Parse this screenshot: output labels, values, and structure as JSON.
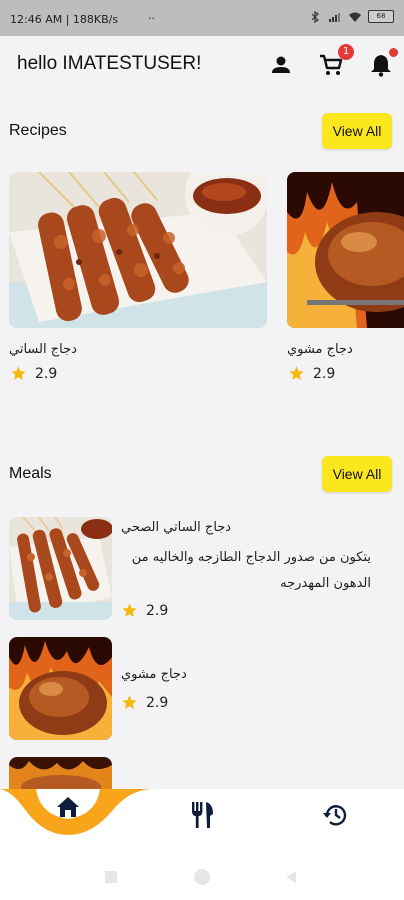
{
  "status_bar": {
    "time_info": "12:46 AM | 188KB/s",
    "dots": "··",
    "battery": "68"
  },
  "header": {
    "greeting": "hello IMATESTUSER!",
    "cart_count": "1"
  },
  "recipes": {
    "title": "Recipes",
    "view_all": "View All",
    "items": [
      {
        "name": "دجاج الساتي",
        "rating": "2.9"
      },
      {
        "name": "دجاج مشوي",
        "rating": "2.9"
      }
    ]
  },
  "meals": {
    "title": "Meals",
    "view_all": "View All",
    "items": [
      {
        "name": "دجاج الساتي الصحي",
        "description": "يتكون من صدور الدجاج الطازجه والخاليه من الدهون المهدرجه",
        "rating": "2.9"
      },
      {
        "name": "دجاج مشوي",
        "description": "",
        "rating": "2.9"
      }
    ]
  },
  "colors": {
    "accent_yellow": "#fce61e",
    "nav_orange": "#f8a51b",
    "badge_red": "#e53935",
    "star_gold": "#f5b80b",
    "nav_icon": "#0d1e3a"
  },
  "icons": {
    "profile": "person-icon",
    "cart": "shopping-cart-icon",
    "notifications": "bell-icon",
    "nav_home": "home-icon",
    "nav_meals": "fork-knife-icon",
    "nav_history": "history-icon"
  }
}
